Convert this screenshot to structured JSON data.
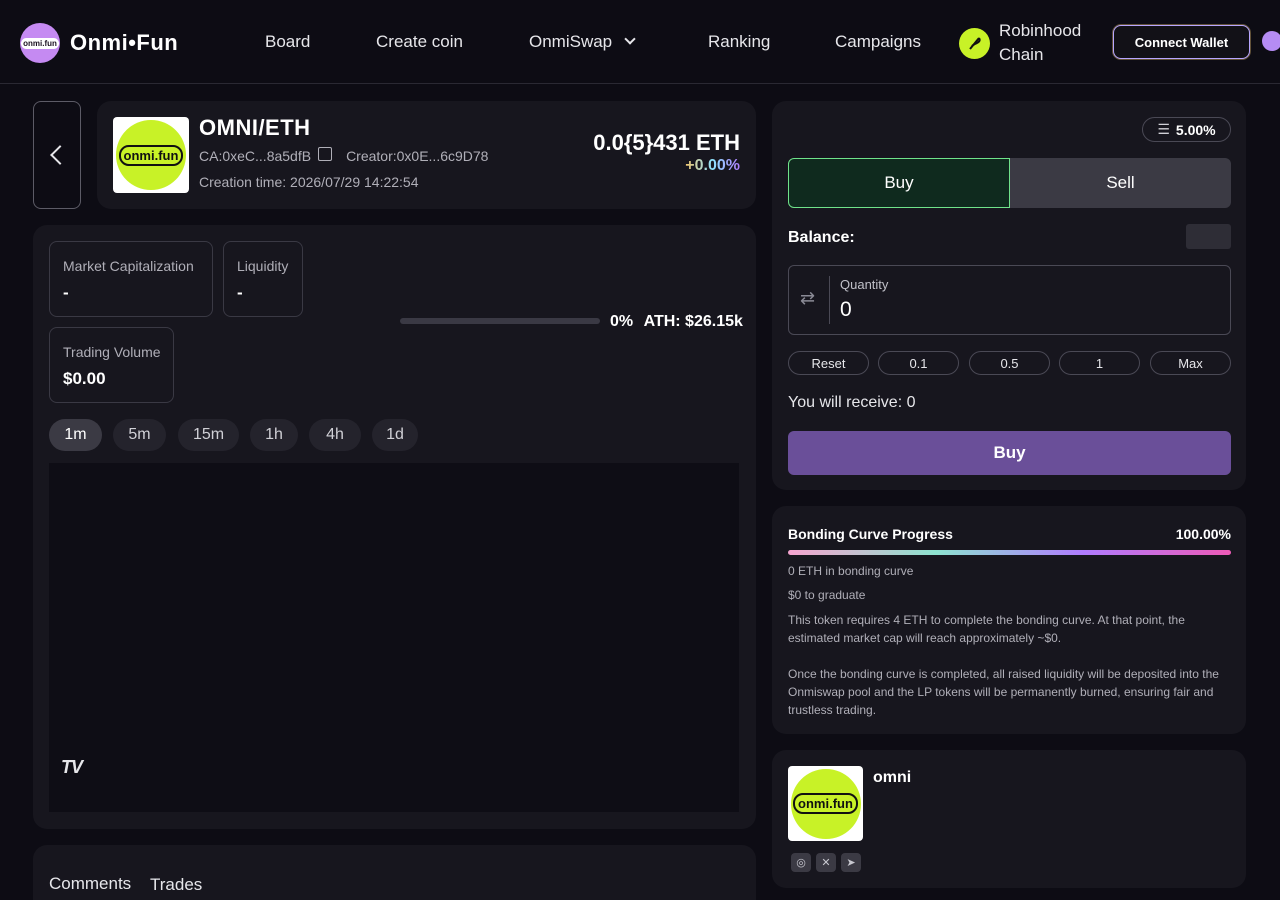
{
  "header": {
    "logo_badge": "onmi.fun",
    "logo_text": "Onmi•Fun",
    "nav": [
      "Board",
      "Create coin",
      "OnmiSwap",
      "Ranking",
      "Campaigns"
    ],
    "chain_line1": "Robinhood",
    "chain_line2": "Chain",
    "connect_wallet": "Connect Wallet"
  },
  "token": {
    "logo_text": "onmi.fun",
    "pair": "OMNI/ETH",
    "ca": "CA:0xeC...8a5dfB",
    "creator": "Creator:0x0E...6c9D78",
    "creation_time": "Creation time: 2026/07/29 14:22:54",
    "price": "0.0{5}431 ETH",
    "change": "+0.00%"
  },
  "stats": {
    "market_cap_label": "Market Capitalization",
    "market_cap_value": "-",
    "liquidity_label": "Liquidity",
    "liquidity_value": "-",
    "volume_label": "Trading Volume",
    "volume_value": "$0.00",
    "progress_pct": "0%",
    "ath": "ATH: $26.15k",
    "progress_fraction": 0
  },
  "timeframes": [
    "1m",
    "5m",
    "15m",
    "1h",
    "4h",
    "1d"
  ],
  "chart_watermark": "TV",
  "tabs": {
    "comments": "Comments",
    "trades": "Trades"
  },
  "trade": {
    "slippage": "5.00%",
    "buy_tab": "Buy",
    "sell_tab": "Sell",
    "balance_label": "Balance:",
    "quantity_label": "Quantity",
    "quantity_value": "0",
    "quick": [
      "Reset",
      "0.1",
      "0.5",
      "1",
      "Max"
    ],
    "receive": "You will receive: 0",
    "buy_button": "Buy"
  },
  "bonding": {
    "title": "Bonding Curve Progress",
    "percent": "100.00%",
    "progress_fraction": 1.0,
    "eth_in_curve": "0 ETH in bonding curve",
    "to_graduate": "$0 to graduate",
    "desc1": "This token requires 4 ETH to complete the bonding curve. At that point, the estimated market cap will reach approximately ~$0.",
    "desc2": "Once the bonding curve is completed, all raised liquidity will be deposited into the Onmiswap pool and the LP tokens will be permanently burned, ensuring fair and trustless trading."
  },
  "profile": {
    "logo_text": "onmi.fun",
    "name": "omni",
    "socials": [
      "web",
      "x",
      "telegram"
    ]
  },
  "colors": {
    "accent_green": "#6fe38a",
    "buy_purple": "#6a4f99",
    "lime": "#c8f227"
  }
}
